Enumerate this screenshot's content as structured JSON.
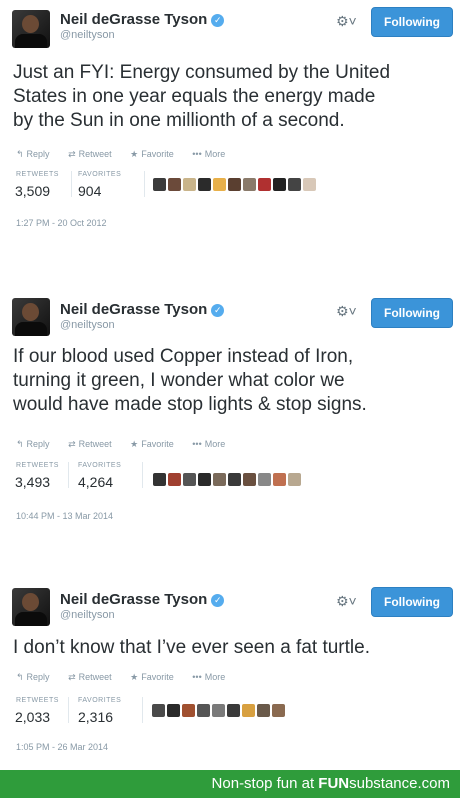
{
  "tweets": [
    {
      "name": "Neil deGrasse Tyson",
      "handle": "@neiltyson",
      "follow_label": "Following",
      "text_lines": [
        "Just an FYI: Energy consumed by the United",
        "States in one year equals the energy made",
        "by the Sun in one millionth of a second."
      ],
      "actions": [
        "Reply",
        "Retweet",
        "Favorite",
        "More"
      ],
      "retweets_label": "RETWEETS",
      "retweets": "3,509",
      "favorites_label": "FAVORITES",
      "favorites": "904",
      "date": "1:27 PM - 20 Oct 2012"
    },
    {
      "name": "Neil deGrasse Tyson",
      "handle": "@neiltyson",
      "follow_label": "Following",
      "text_lines": [
        "If our blood used Copper instead of Iron,",
        "turning it green, I wonder what color we",
        "would have made stop lights & stop signs."
      ],
      "actions": [
        "Reply",
        "Retweet",
        "Favorite",
        "More"
      ],
      "retweets_label": "RETWEETS",
      "retweets": "3,493",
      "favorites_label": "FAVORITES",
      "favorites": "4,264",
      "date": "10:44 PM - 13 Mar 2014"
    },
    {
      "name": "Neil deGrasse Tyson",
      "handle": "@neiltyson",
      "follow_label": "Following",
      "text_lines": [
        "I don’t know that I’ve ever seen a fat turtle."
      ],
      "actions": [
        "Reply",
        "Retweet",
        "Favorite",
        "More"
      ],
      "retweets_label": "RETWEETS",
      "retweets": "2,033",
      "favorites_label": "FAVORITES",
      "favorites": "2,316",
      "date": "1:05 PM - 26 Mar 2014"
    }
  ],
  "icons": {
    "verified": "verified-check-icon",
    "gear": "gear-icon",
    "reply": "reply-icon",
    "retweet": "retweet-icon",
    "favorite": "star-icon",
    "more": "more-dots-icon"
  },
  "footer": {
    "prefix": "Non-stop fun at",
    "brand_bold": "FUN",
    "brand_rest": "substance.com"
  },
  "colors": {
    "follow_button": "#3b94d9",
    "verified": "#55acee",
    "footer": "#2f9c3b",
    "muted": "#8899a6",
    "text": "#292f33"
  }
}
